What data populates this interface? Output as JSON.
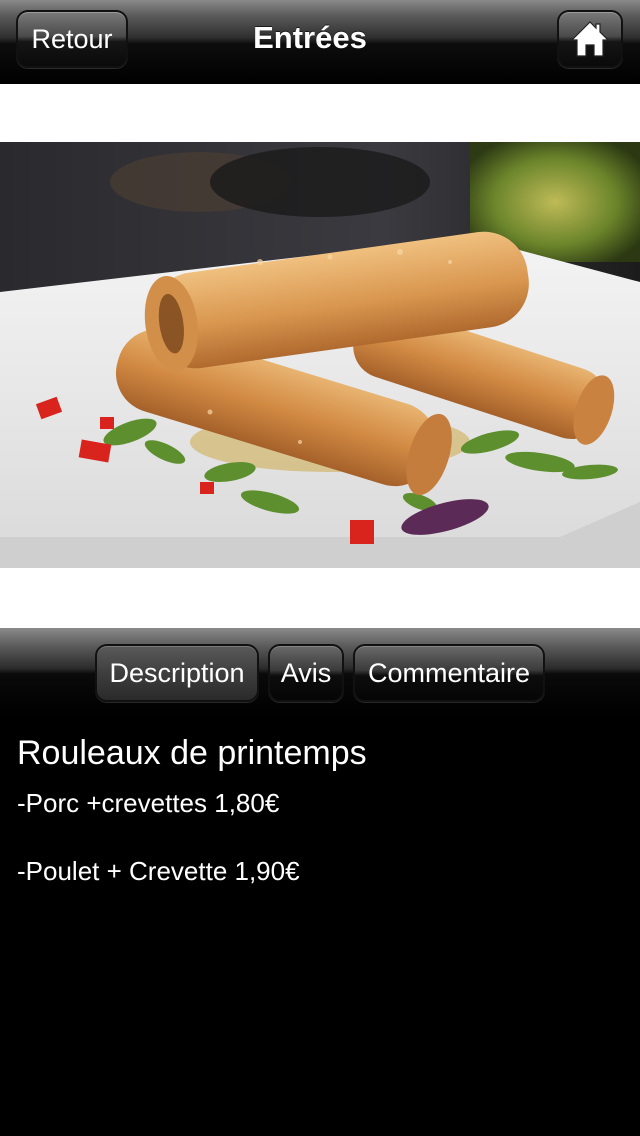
{
  "navbar": {
    "back_label": "Retour",
    "title": "Entrées",
    "home_icon": "home-icon"
  },
  "tabs": [
    {
      "label": "Description",
      "active": true
    },
    {
      "label": "Avis",
      "active": false
    },
    {
      "label": "Commentaire",
      "active": false
    }
  ],
  "dish": {
    "title": "Rouleaux de printemps",
    "prices": [
      "-Porc +crevettes 1,80€",
      "-Poulet + Crevette 1,90€"
    ]
  },
  "colors": {
    "background": "#000000",
    "text": "#ffffff",
    "photo_frame": "#ffffff"
  }
}
